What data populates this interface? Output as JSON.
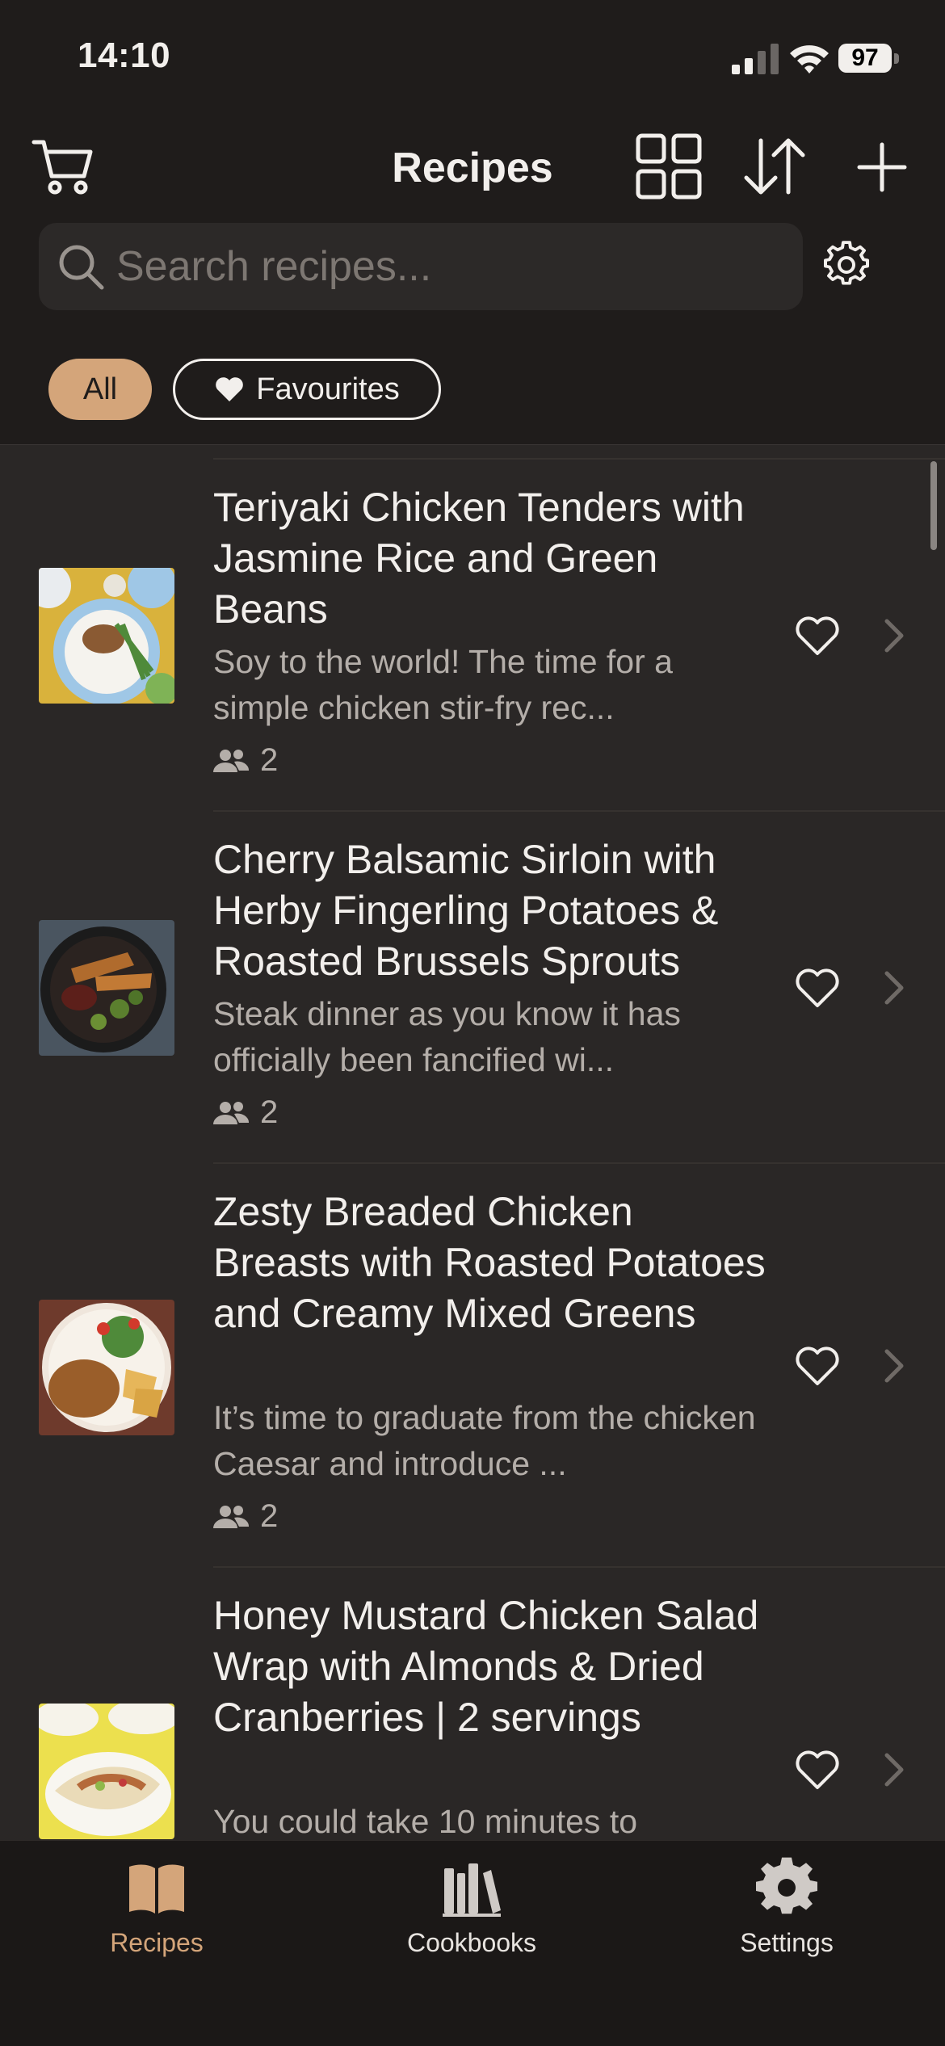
{
  "status_bar": {
    "time": "14:10",
    "battery": "97"
  },
  "header": {
    "title": "Recipes"
  },
  "search": {
    "placeholder": "Search recipes..."
  },
  "filters": {
    "all": "All",
    "favourites": "Favourites"
  },
  "recipes": [
    {
      "title": "Teriyaki Chicken Tenders with Jasmine Rice and Green Beans",
      "description": "Soy to the world! The time for a simple chicken stir-fry rec...",
      "servings": "2",
      "image": "food-plate-image"
    },
    {
      "title": "Cherry Balsamic Sirloin with Herby Fingerling Potatoes & Roasted Brussels Sprouts",
      "description": "Steak dinner as you know it has officially been fancified wi...",
      "servings": "2",
      "image": "food-pan-image"
    },
    {
      "title": "Zesty Breaded Chicken Breasts with Roasted Potatoes and Creamy Mixed Greens",
      "description": "It’s time to graduate from the chicken Caesar and introduce ...",
      "servings": "2",
      "image": "food-plate-image"
    },
    {
      "title": "Honey Mustard Chicken Salad Wrap with Almonds & Dried Cranberries | 2 servings",
      "description": "You could take 10 minutes to",
      "servings": "",
      "image": "food-wrap-image"
    }
  ],
  "tabs": [
    {
      "label": "Recipes",
      "icon": "book-icon",
      "active": true
    },
    {
      "label": "Cookbooks",
      "icon": "bookshelf-icon",
      "active": false
    },
    {
      "label": "Settings",
      "icon": "gear-icon",
      "active": false
    }
  ],
  "colors": {
    "accent": "#d4a57a",
    "background": "#1f1c1b",
    "list_bg": "#2a2726",
    "muted_text": "#b4aea9"
  }
}
